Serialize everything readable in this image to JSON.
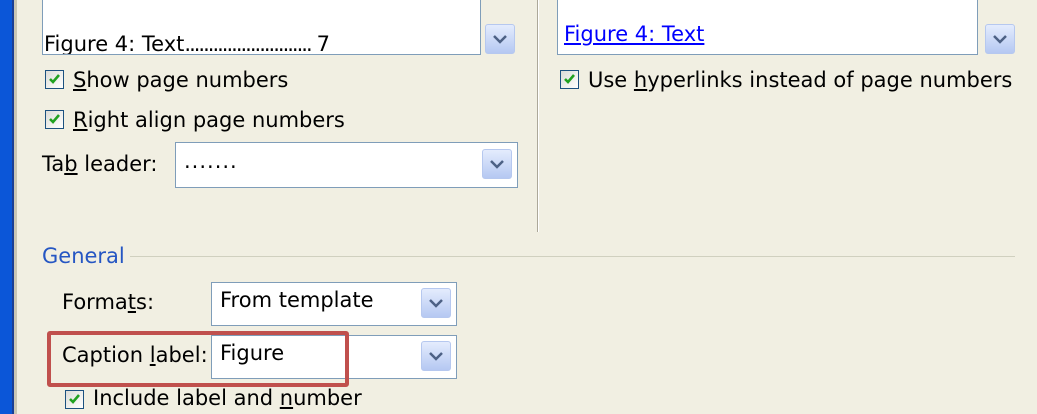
{
  "left_preview": {
    "entry_label": "Figure 4: Text",
    "entry_leader": "...........................",
    "entry_page": "7"
  },
  "right_preview": {
    "entry_link": "Figure 4: Text"
  },
  "options": {
    "show_page_numbers": {
      "pre": "",
      "accel": "S",
      "post": "how page numbers",
      "checked": true
    },
    "right_align": {
      "pre": "",
      "accel": "R",
      "post": "ight align page numbers",
      "checked": true
    },
    "use_hyperlinks": {
      "pre": "Use ",
      "accel": "h",
      "post": "yperlinks instead of page numbers",
      "checked": true
    },
    "include_label": {
      "pre": "Include label and ",
      "accel": "n",
      "post": "umber",
      "checked": true
    }
  },
  "tab_leader": {
    "pre": "Ta",
    "accel": "b",
    "post": " leader:",
    "value": "......."
  },
  "general": {
    "title": "General",
    "formats": {
      "pre": "Forma",
      "accel": "t",
      "post": "s:",
      "value": "From template"
    },
    "caption": {
      "pre": "Caption ",
      "accel": "l",
      "post": "abel:",
      "value": "Figure"
    }
  },
  "colors": {
    "accent": "#2556c3",
    "highlight": "#c0504d",
    "link": "#0000ff"
  }
}
